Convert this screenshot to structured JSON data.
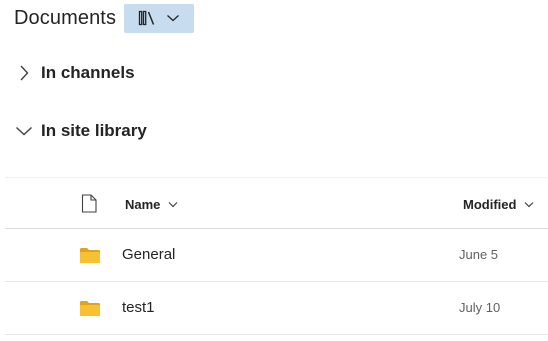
{
  "header": {
    "title": "Documents",
    "library_button_icon": "library-icon",
    "library_button_dropdown_icon": "chevron-down-icon"
  },
  "sections": [
    {
      "label": "In channels",
      "expanded": false,
      "icon": "chevron-right-icon"
    },
    {
      "label": "In site library",
      "expanded": true,
      "icon": "chevron-down-icon"
    }
  ],
  "table": {
    "columns": {
      "type_icon": "document-icon",
      "name": "Name",
      "modified": "Modified"
    },
    "rows": [
      {
        "name": "General",
        "modified": "June 5",
        "icon": "folder-icon"
      },
      {
        "name": "test1",
        "modified": "July 10",
        "icon": "folder-icon"
      }
    ]
  },
  "colors": {
    "library_button_bg": "#c7dcef",
    "folder": "#f6c233",
    "folder_back": "#e0a417"
  }
}
